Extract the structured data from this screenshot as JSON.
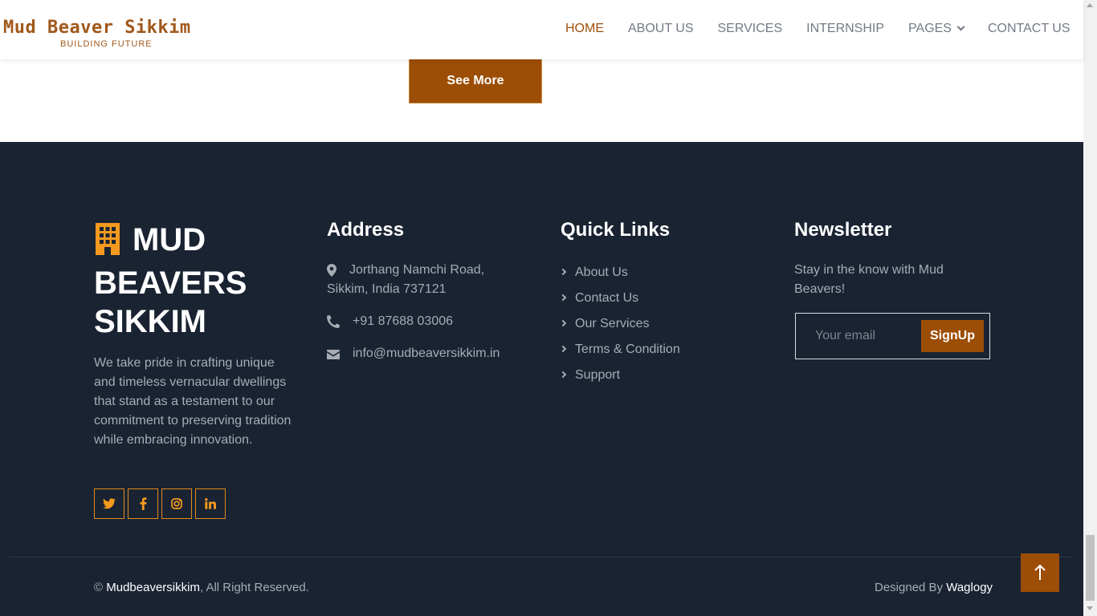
{
  "header": {
    "logo_title": "Mud Beaver Sikkim",
    "logo_tagline": "BUILDING FUTURE",
    "nav": [
      {
        "label": "HOME",
        "active": true
      },
      {
        "label": "ABOUT US"
      },
      {
        "label": "SERVICES"
      },
      {
        "label": "INTERNSHIP"
      },
      {
        "label": "PAGES",
        "dropdown": true
      },
      {
        "label": "CONTACT US"
      }
    ]
  },
  "main": {
    "see_more_label": "See More"
  },
  "footer": {
    "brand_line1": "MUD",
    "brand_line2": "BEAVERS",
    "brand_line3": "SIKKIM",
    "brand_icon": "building-icon",
    "about_text": "We take pride in crafting unique and timeless vernacular dwellings that stand as a testament to our commitment to preserving tradition while embracing innovation.",
    "socials": [
      "twitter-icon",
      "facebook-icon",
      "instagram-icon",
      "linkedin-icon"
    ],
    "address": {
      "title": "Address",
      "line1": "Jorthang Namchi Road,",
      "line2": "Sikkim, India 737121",
      "phone": "+91 87688 03006",
      "email": "info@mudbeaversikkim.in"
    },
    "quick_links": {
      "title": "Quick Links",
      "items": [
        "About Us",
        "Contact Us",
        "Our Services",
        "Terms & Condition",
        "Support"
      ]
    },
    "newsletter": {
      "title": "Newsletter",
      "text": "Stay in the know with Mud Beavers!",
      "placeholder": "Your email",
      "button": "SignUp"
    },
    "copyright_prefix": "©",
    "copyright_name": "Mudbeaversikkim",
    "copyright_suffix": ", All Right Reserved.",
    "designed_by_prefix": "Designed By",
    "designed_by_name": "Waglogy"
  },
  "colors": {
    "accent": "#9c4d06",
    "footer_bg": "#1a2332",
    "social_border": "#e08b1a"
  }
}
